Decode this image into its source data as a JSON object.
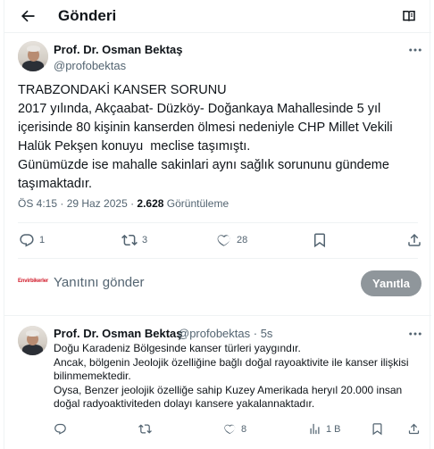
{
  "header": {
    "title": "Gönderi"
  },
  "main_post": {
    "author_name": "Prof. Dr. Osman Bektaş",
    "author_handle": "@profobektas",
    "text": "TRABZONDAKİ KANSER SORUNU\n2017 yılında, Akçaabat- Düzköy- Doğankaya Mahallesinde 5 yıl içerisinde 80 kişinin kanserden ölmesi nedeniyle CHP Millet Vekili Halük Pekşen konuyu  meclise taşımıştı.\nGünümüzde ise mahalle sakinlari aynı sağlık sorununu gündeme taşımaktadır.",
    "time": "ÖS 4:15 · 29 Haz 2025 · ",
    "views_count": "2.628",
    "views_label": "Görüntüleme",
    "replies": "1",
    "reposts": "3",
    "likes": "28"
  },
  "reply_composer": {
    "avatar_text": "Envirbikerler",
    "placeholder": "Yanıtını gönder",
    "button_label": "Yanıtla"
  },
  "reply_post": {
    "author_name": "Prof. Dr. Osman Bektaş",
    "author_handle": "@profobektas",
    "time": "· 5s",
    "text": "Doğu Karadeniz Bölgesinde kanser türleri yaygındır.\nAncak, bölgenin Jeolojik özelliğine bağlı doğal rayoaktivite ile kanser ilişkisi bilinmemektedir.\nOysa, Benzer jeolojik özelliğe sahip Kuzey Amerikada heryıl 20.000 insan doğal radyoaktiviteden dolayı kansere yakalannaktadır.",
    "likes": "8",
    "views": "1 B"
  },
  "colors": {
    "text": "#0f1419",
    "muted": "#536471",
    "border": "#eff3f4",
    "button": "#8f969b"
  }
}
